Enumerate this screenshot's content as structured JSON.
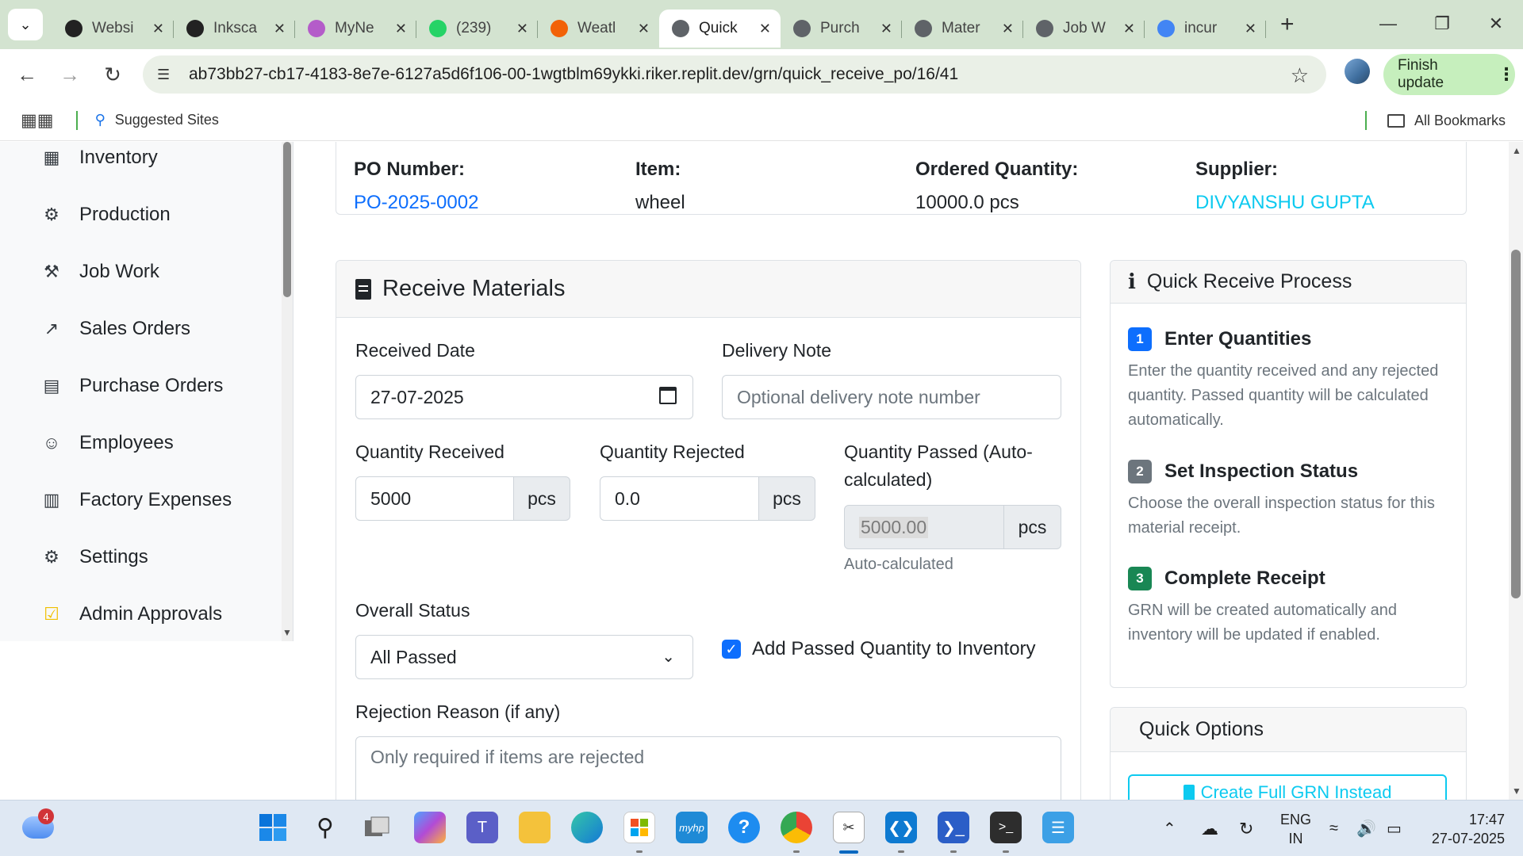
{
  "browser": {
    "tabs": [
      {
        "title": "Websi",
        "icon": "openai-icon",
        "color": "#222222"
      },
      {
        "title": "Inksca",
        "icon": "inkscape-icon",
        "color": "#222222"
      },
      {
        "title": "MyNe",
        "icon": "cloud-icon",
        "color": "#b45cc9"
      },
      {
        "title": "(239)",
        "icon": "whatsapp-icon",
        "color": "#25d366"
      },
      {
        "title": "Weatl",
        "icon": "replit-icon",
        "color": "#f26207"
      },
      {
        "title": "Quick",
        "icon": "globe-icon",
        "color": "#5f6368",
        "active": true
      },
      {
        "title": "Purch",
        "icon": "globe-icon",
        "color": "#5f6368"
      },
      {
        "title": "Mater",
        "icon": "globe-icon",
        "color": "#5f6368"
      },
      {
        "title": "Job W",
        "icon": "globe-icon",
        "color": "#5f6368"
      },
      {
        "title": "incur",
        "icon": "google-icon",
        "color": "#4285f4"
      }
    ],
    "url": "ab73bb27-cb17-4183-8e7e-6127a5d6f106-00-1wgtblm69ykki.riker.replit.dev/grn/quick_receive_po/16/41",
    "finish_update": "Finish update",
    "bookmarks": {
      "suggested": "Suggested Sites",
      "all": "All Bookmarks"
    }
  },
  "sidebar": {
    "items": [
      {
        "label": "Inventory",
        "icon": "boxes-icon"
      },
      {
        "label": "Production",
        "icon": "cogs-icon"
      },
      {
        "label": "Job Work",
        "icon": "tools-icon"
      },
      {
        "label": "Sales Orders",
        "icon": "chart-line-icon"
      },
      {
        "label": "Purchase Orders",
        "icon": "file-invoice-icon"
      },
      {
        "label": "Employees",
        "icon": "users-icon"
      },
      {
        "label": "Factory Expenses",
        "icon": "receipt-icon"
      },
      {
        "label": "Settings",
        "icon": "gear-icon"
      },
      {
        "label": "Admin Approvals",
        "icon": "clipboard-check-icon"
      }
    ]
  },
  "po": {
    "number_label": "PO Number:",
    "number": "PO-2025-0002",
    "item_label": "Item:",
    "item": "wheel",
    "qty_label": "Ordered Quantity:",
    "qty": "10000.0 pcs",
    "supplier_label": "Supplier:",
    "supplier": "DIVYANSHU GUPTA"
  },
  "receive": {
    "title": "Receive Materials",
    "received_date_label": "Received Date",
    "received_date": "27-07-2025",
    "delivery_note_label": "Delivery Note",
    "delivery_note_placeholder": "Optional delivery note number",
    "qty_received_label": "Quantity Received",
    "qty_received": "5000",
    "qty_rejected_label": "Quantity Rejected",
    "qty_rejected": "0.0",
    "qty_passed_label": "Quantity Passed (Auto-calculated)",
    "qty_passed": "5000.00",
    "unit": "pcs",
    "auto_hint": "Auto-calculated",
    "overall_status_label": "Overall Status",
    "overall_status": "All Passed",
    "add_inventory_label": "Add Passed Quantity to Inventory",
    "add_inventory_checked": true,
    "rejection_reason_label": "Rejection Reason (if any)",
    "rejection_reason_placeholder": "Only required if items are rejected"
  },
  "process": {
    "title": "Quick Receive Process",
    "steps": [
      {
        "num": "1",
        "title": "Enter Quantities",
        "color": "#0d6efd",
        "desc": "Enter the quantity received and any rejected quantity. Passed quantity will be calculated automatically."
      },
      {
        "num": "2",
        "title": "Set Inspection Status",
        "color": "#6c757d",
        "desc": "Choose the overall inspection status for this material receipt."
      },
      {
        "num": "3",
        "title": "Complete Receipt",
        "color": "#198754",
        "desc": "GRN will be created automatically and inventory will be updated if enabled."
      }
    ]
  },
  "options": {
    "title": "Quick Options",
    "full_grn": "Create Full GRN Instead"
  },
  "taskbar": {
    "weather_badge": "4",
    "lang": "ENG",
    "region": "IN",
    "time": "17:47",
    "date": "27-07-2025"
  }
}
